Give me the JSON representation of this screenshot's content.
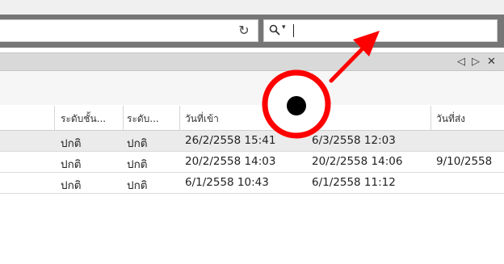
{
  "search": {
    "dropdown_glyph": "▾",
    "icons": {
      "refresh": "refresh-icon",
      "search": "search-icon"
    }
  },
  "tab_controls": {
    "prev": "◁",
    "next": "▷",
    "close": "✕"
  },
  "table": {
    "columns": [
      "ระดับชั้น...",
      "ระดับ...",
      "วันที่เข้า",
      "",
      "วันที่ส่ง"
    ],
    "rows": [
      [
        "ปกติ",
        "ปกติ",
        "26/2/2558 15:41",
        "6/3/2558 12:03",
        ""
      ],
      [
        "ปกติ",
        "ปกติ",
        "20/2/2558 14:03",
        "20/2/2558 14:06",
        "9/10/2558"
      ],
      [
        "ปกติ",
        "ปกติ",
        "6/1/2558 10:43",
        "6/1/2558 11:12",
        ""
      ]
    ]
  },
  "annotation": {
    "color": "#ff0000",
    "dot_color": "#000000"
  }
}
